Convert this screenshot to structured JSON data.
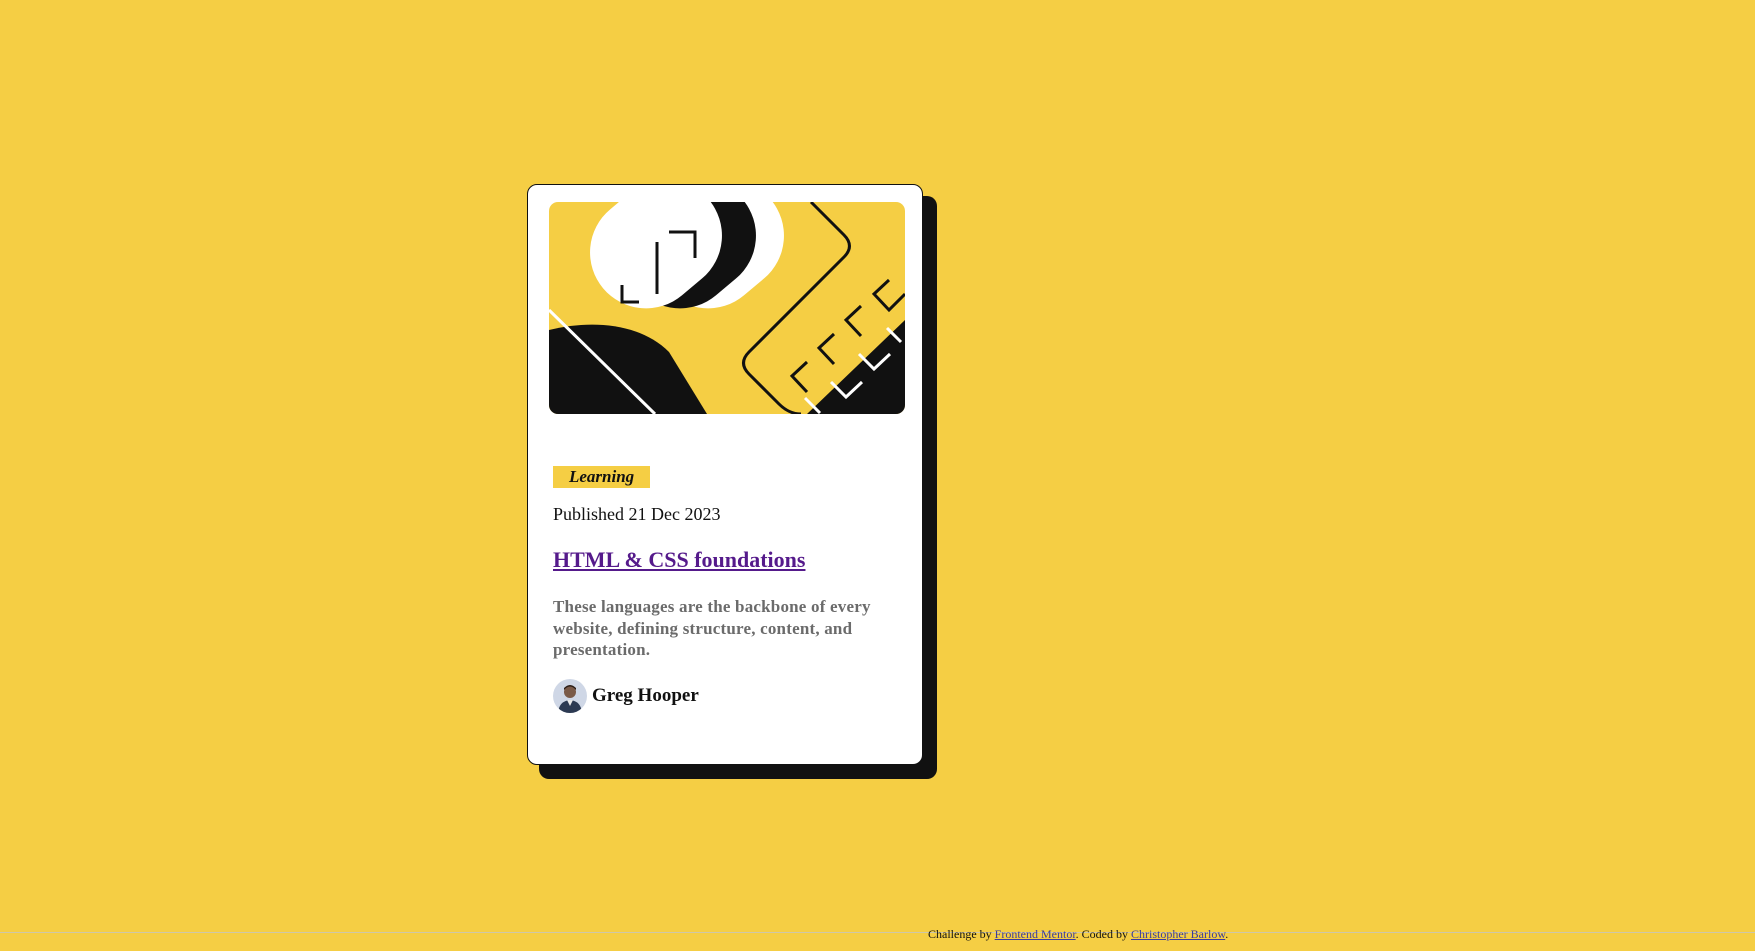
{
  "colors": {
    "background": "#F5CE44",
    "card": "#FFFFFF",
    "ink": "#111111",
    "tag_bg": "#F5CE44",
    "link_visited": "#551A8B",
    "description": "#6B6B6B",
    "footer_link": "#3B3B9B"
  },
  "card": {
    "image_alt": "illustration-article",
    "tag": "Learning",
    "published": "Published 21 Dec 2023",
    "title": "HTML & CSS foundations",
    "description": "These languages are the backbone of every website, defining structure, content, and presentation.",
    "author": {
      "name": "Greg Hooper",
      "avatar_icon": "person-avatar-icon"
    }
  },
  "footer": {
    "prefix": "Challenge by ",
    "link1": "Frontend Mentor",
    "middle": ". Coded by ",
    "link2": "Christopher Barlow",
    "suffix": "."
  }
}
